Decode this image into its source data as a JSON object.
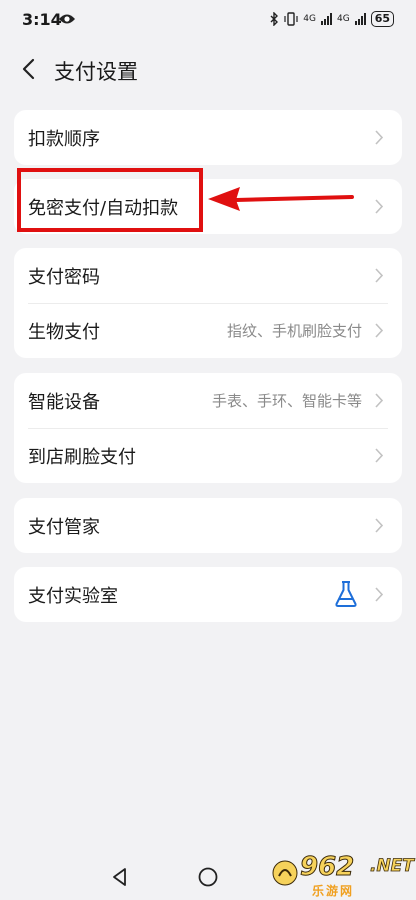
{
  "status_bar": {
    "time": "3:14",
    "battery": "65",
    "network_label": "4G"
  },
  "header": {
    "title": "支付设置"
  },
  "sections": [
    {
      "items": [
        {
          "label": "扣款顺序",
          "sub": ""
        }
      ]
    },
    {
      "items": [
        {
          "label": "免密支付/自动扣款",
          "sub": ""
        }
      ]
    },
    {
      "items": [
        {
          "label": "支付密码",
          "sub": ""
        },
        {
          "label": "生物支付",
          "sub": "指纹、手机刷脸支付"
        }
      ]
    },
    {
      "items": [
        {
          "label": "智能设备",
          "sub": "手表、手环、智能卡等"
        },
        {
          "label": "到店刷脸支付",
          "sub": ""
        }
      ]
    },
    {
      "items": [
        {
          "label": "支付管家",
          "sub": ""
        }
      ]
    },
    {
      "items": [
        {
          "label": "支付实验室",
          "sub": "",
          "icon": "flask-icon"
        }
      ]
    }
  ],
  "annotation": {
    "highlight_color": "#e01010"
  },
  "watermark": {
    "brand": "962",
    "suffix": ".NET",
    "sub": "乐游网"
  }
}
